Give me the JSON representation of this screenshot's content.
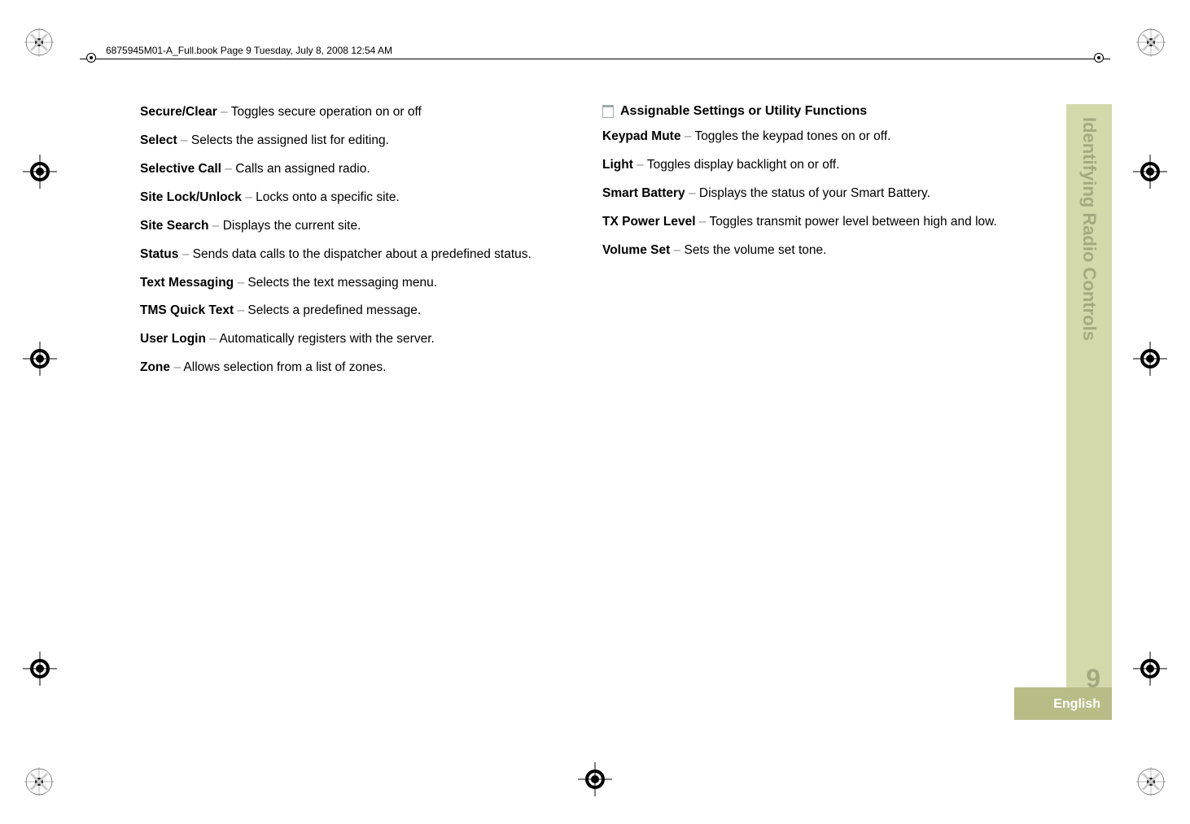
{
  "header": {
    "line": "6875945M01-A_Full.book  Page 9  Tuesday, July 8, 2008  12:54 AM"
  },
  "left": [
    {
      "label": "Secure/Clear",
      "desc": "Toggles secure operation on or off"
    },
    {
      "label": "Select",
      "desc": "Selects the assigned list for editing."
    },
    {
      "label": "Selective Call",
      "desc": "Calls an assigned radio."
    },
    {
      "label": "Site Lock/Unlock",
      "desc": "Locks onto a specific site."
    },
    {
      "label": "Site Search",
      "desc": "Displays the current site."
    },
    {
      "label": "Status",
      "desc": "Sends data calls to the dispatcher about a predefined status."
    },
    {
      "label": "Text Messaging",
      "desc": "Selects the text messaging menu."
    },
    {
      "label": "TMS Quick Text",
      "desc": "Selects a predefined message."
    },
    {
      "label": "User Login",
      "desc": "Automatically registers with the server."
    },
    {
      "label": "Zone",
      "desc": "Allows selection from a list of zones."
    }
  ],
  "right": {
    "section_title": "Assignable Settings or Utility Functions",
    "items": [
      {
        "label": "Keypad Mute",
        "desc": "Toggles the keypad tones on or off."
      },
      {
        "label": "Light",
        "desc": "Toggles display backlight on or off."
      },
      {
        "label": "Smart Battery",
        "desc": "Displays the status of your Smart Battery."
      },
      {
        "label": "TX Power Level",
        "desc": "Toggles transmit power level between high and low."
      },
      {
        "label": "Volume Set",
        "desc": "Sets the volume set tone."
      }
    ]
  },
  "side": {
    "tab_label": "Identifying Radio Controls",
    "page_number": "9",
    "language": "English"
  }
}
